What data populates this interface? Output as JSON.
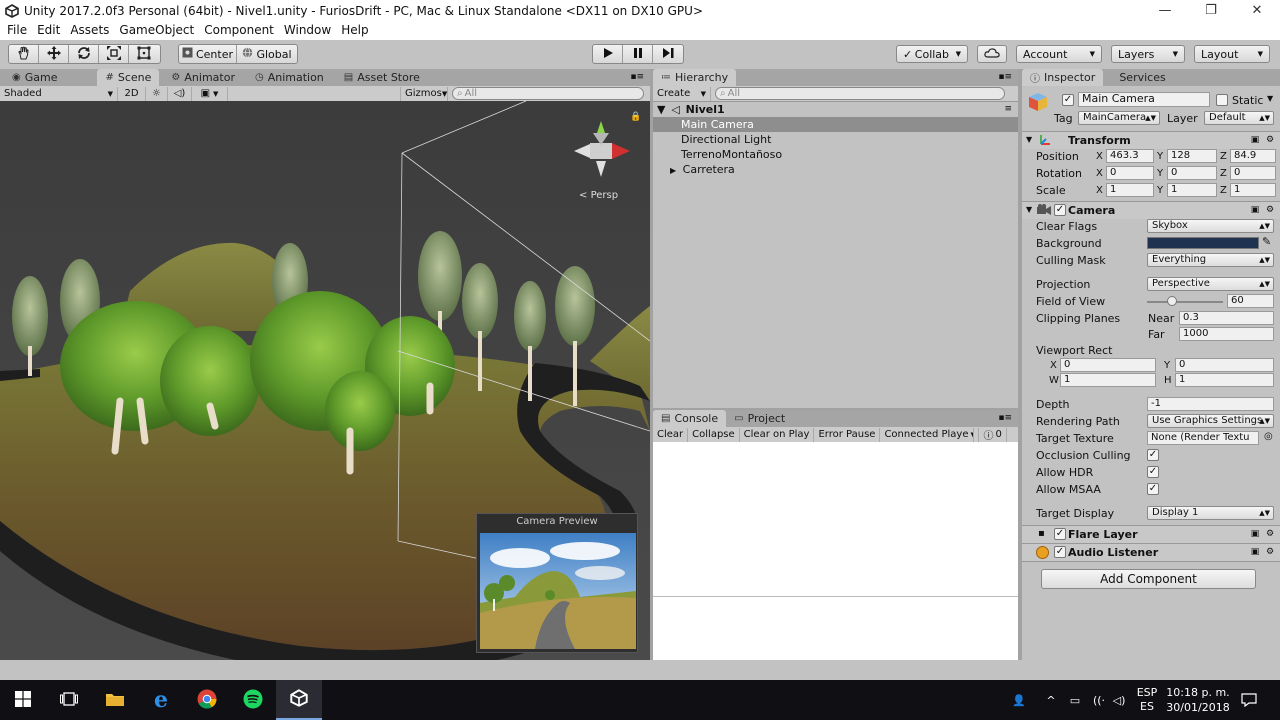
{
  "window": {
    "title": "Unity 2017.2.0f3 Personal (64bit) - Nivel1.unity - FuriosDrift - PC, Mac & Linux Standalone <DX11 on DX10 GPU>"
  },
  "menu": [
    "File",
    "Edit",
    "Assets",
    "GameObject",
    "Component",
    "Window",
    "Help"
  ],
  "toolbar": {
    "pivot_label": "Center",
    "space_label": "Global",
    "collab_label": "Collab",
    "account_label": "Account",
    "layers_label": "Layers",
    "layout_label": "Layout"
  },
  "scene_panel": {
    "tabs": [
      "Game",
      "Scene",
      "Animator",
      "Animation",
      "Asset Store"
    ],
    "active_tab": "Scene",
    "shading_mode": "Shaded",
    "toggle_2d": "2D",
    "gizmos_label": "Gizmos",
    "search_placeholder": "All",
    "persp_label": "Persp",
    "camera_preview_title": "Camera Preview"
  },
  "hierarchy": {
    "tab": "Hierarchy",
    "create_label": "Create",
    "search_placeholder": "All",
    "scene_name": "Nivel1",
    "items": [
      "Main Camera",
      "Directional Light",
      "TerrenoMontañoso",
      "Carretera"
    ]
  },
  "console": {
    "tabs": [
      "Console",
      "Project"
    ],
    "buttons": [
      "Clear",
      "Collapse",
      "Clear on Play",
      "Error Pause",
      "Connected Playe"
    ],
    "count": "0"
  },
  "inspector": {
    "tabs": [
      "Inspector",
      "Services"
    ],
    "object_name": "Main Camera",
    "static_label": "Static",
    "tag_label": "Tag",
    "tag_value": "MainCamera",
    "layer_label": "Layer",
    "layer_value": "Default",
    "transform": {
      "title": "Transform",
      "position_label": "Position",
      "rotation_label": "Rotation",
      "scale_label": "Scale",
      "position": [
        "463.3",
        "128",
        "84.9"
      ],
      "rotation": [
        "0",
        "0",
        "0"
      ],
      "scale": [
        "1",
        "1",
        "1"
      ]
    },
    "camera": {
      "title": "Camera",
      "clear_flags_label": "Clear Flags",
      "clear_flags": "Skybox",
      "background_label": "Background",
      "background_color": "#1f3350",
      "culling_mask_label": "Culling Mask",
      "culling_mask": "Everything",
      "projection_label": "Projection",
      "projection": "Perspective",
      "fov_label": "Field of View",
      "fov": "60",
      "fov_fraction": 0.33,
      "clipping_label": "Clipping Planes",
      "near_label": "Near",
      "near": "0.3",
      "far_label": "Far",
      "far": "1000",
      "viewport_label": "Viewport Rect",
      "viewport": {
        "x": "0",
        "y": "0",
        "w": "1",
        "h": "1"
      },
      "depth_label": "Depth",
      "depth": "-1",
      "rendering_path_label": "Rendering Path",
      "rendering_path": "Use Graphics Settings",
      "target_texture_label": "Target Texture",
      "target_texture": "None (Render Textu",
      "occlusion_label": "Occlusion Culling",
      "hdr_label": "Allow HDR",
      "msaa_label": "Allow MSAA",
      "target_display_label": "Target Display",
      "target_display": "Display 1"
    },
    "flare_layer_title": "Flare Layer",
    "audio_listener_title": "Audio Listener",
    "add_component_label": "Add Component"
  },
  "taskbar": {
    "lang_top": "ESP",
    "lang_bottom": "ES",
    "time": "10:18 p. m.",
    "date": "30/01/2018"
  },
  "colors": {
    "editor_bg": "#c2c2c2",
    "selection": "#8e8e8e",
    "taskbar": "#0f0f14"
  }
}
